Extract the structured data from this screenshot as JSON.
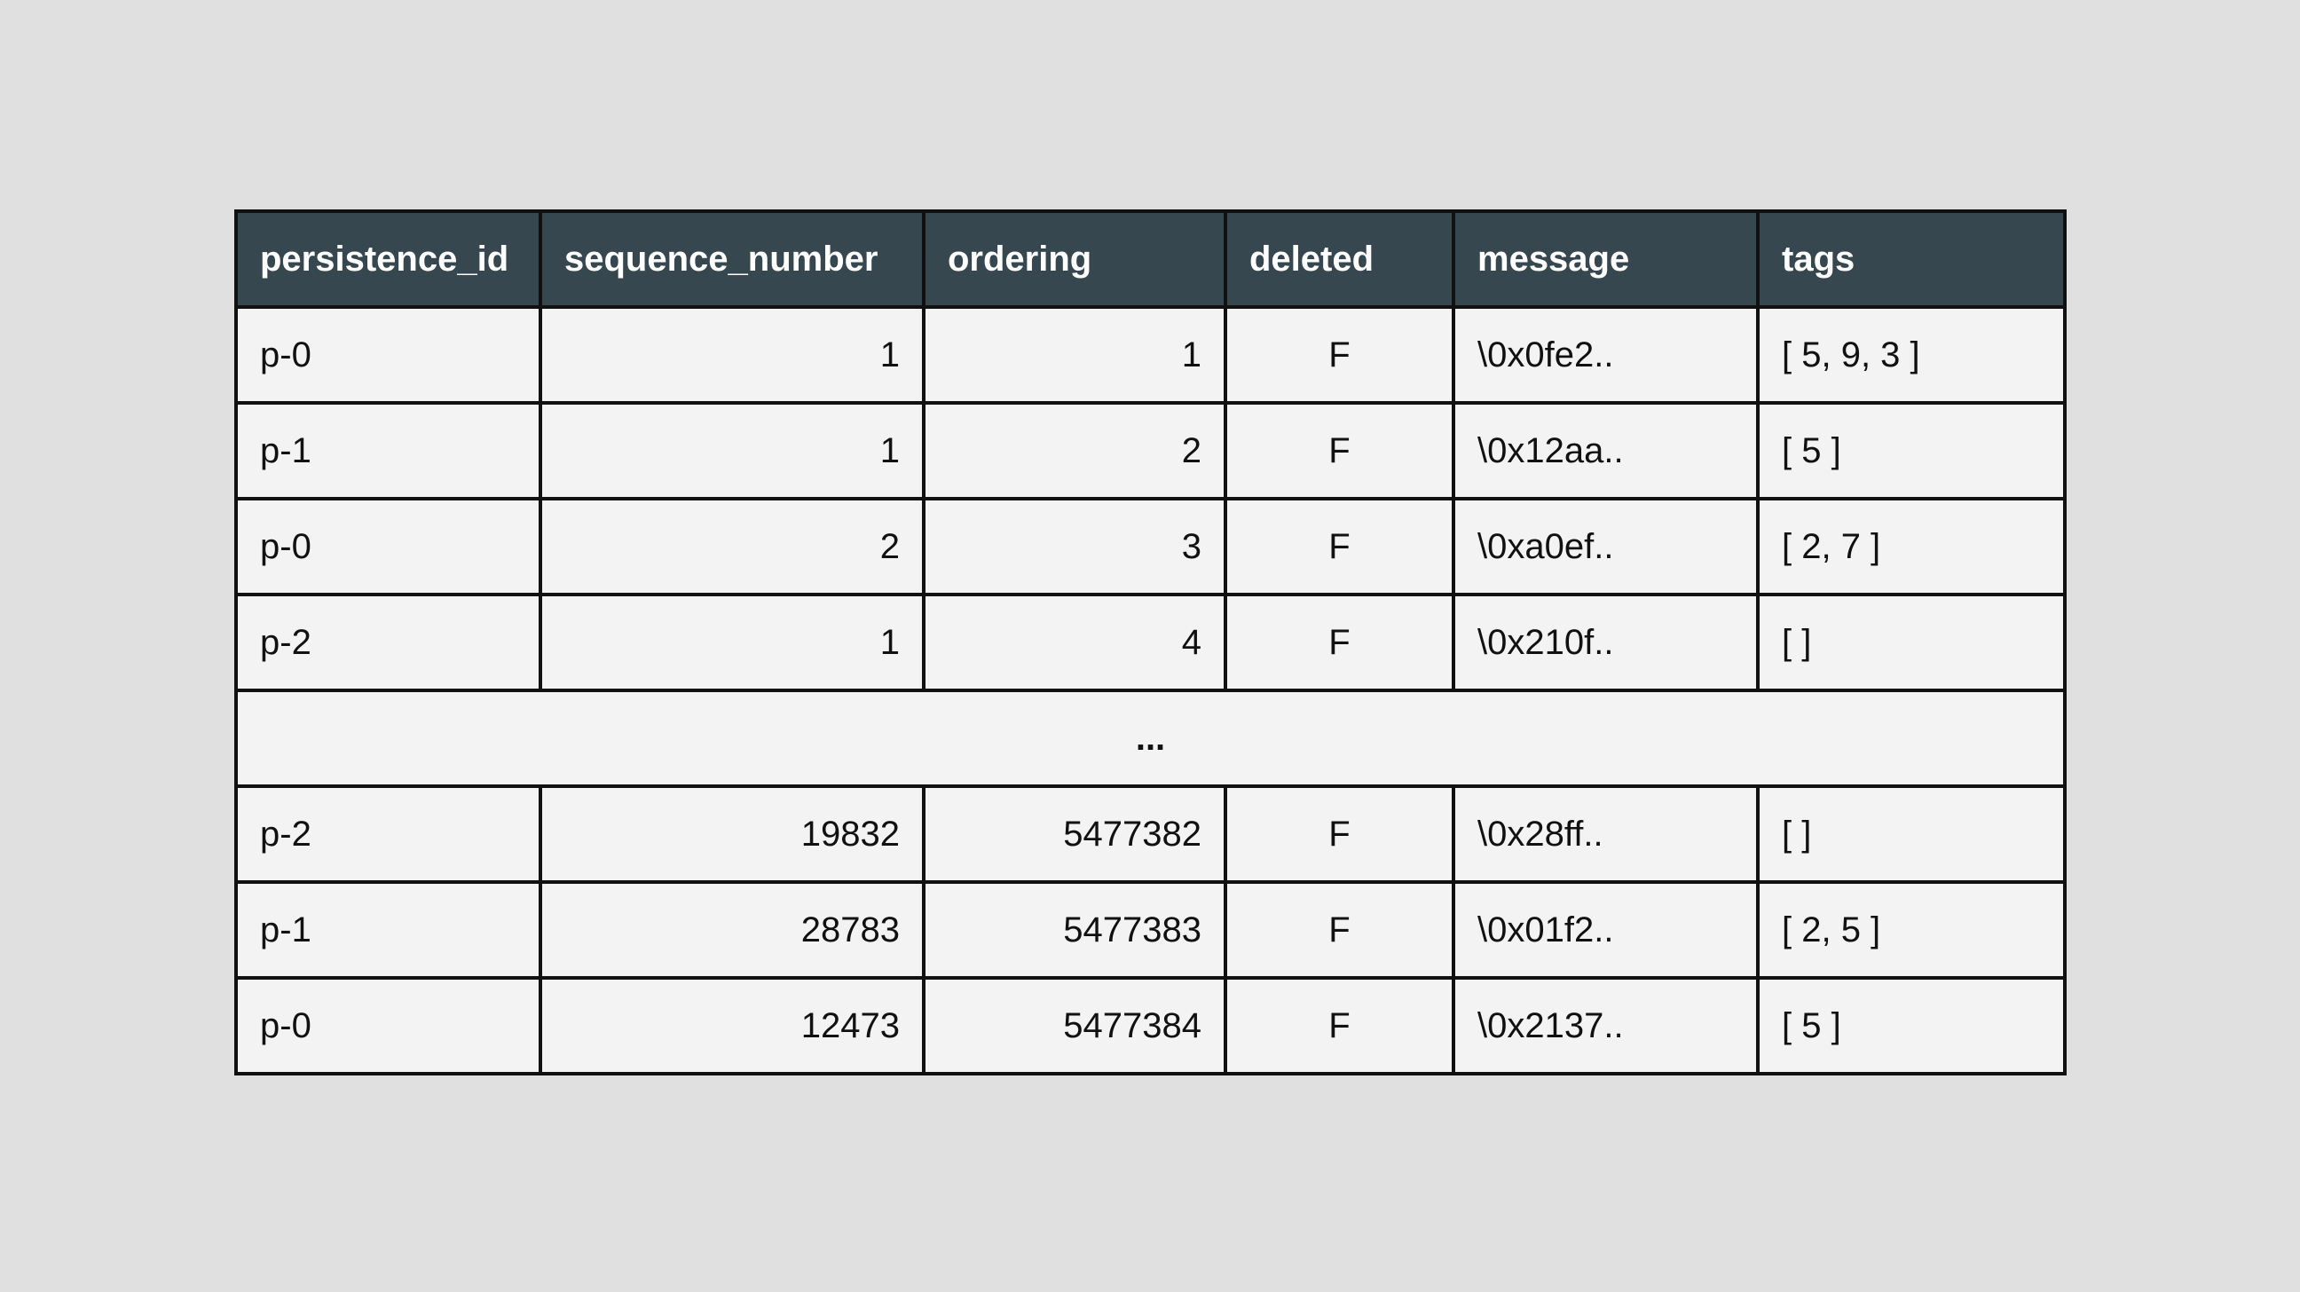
{
  "table": {
    "headers": [
      "persistence_id",
      "sequence_number",
      "ordering",
      "deleted",
      "message",
      "tags"
    ],
    "rows_top": [
      [
        "p-0",
        "1",
        "1",
        "F",
        "\\0x0fe2..",
        "[ 5, 9, 3 ]"
      ],
      [
        "p-1",
        "1",
        "2",
        "F",
        "\\0x12aa..",
        "[ 5 ]"
      ],
      [
        "p-0",
        "2",
        "3",
        "F",
        "\\0xa0ef..",
        "[ 2, 7 ]"
      ],
      [
        "p-2",
        "1",
        "4",
        "F",
        "\\0x210f..",
        "[ ]"
      ]
    ],
    "gap_label": "...",
    "rows_bottom": [
      [
        "p-2",
        "19832",
        "5477382",
        "F",
        "\\0x28ff..",
        "[ ]"
      ],
      [
        "p-1",
        "28783",
        "5477383",
        "F",
        "\\0x01f2..",
        "[ 2, 5 ]"
      ],
      [
        "p-0",
        "12473",
        "5477384",
        "F",
        "\\0x2137..",
        "[ 5 ]"
      ]
    ]
  }
}
